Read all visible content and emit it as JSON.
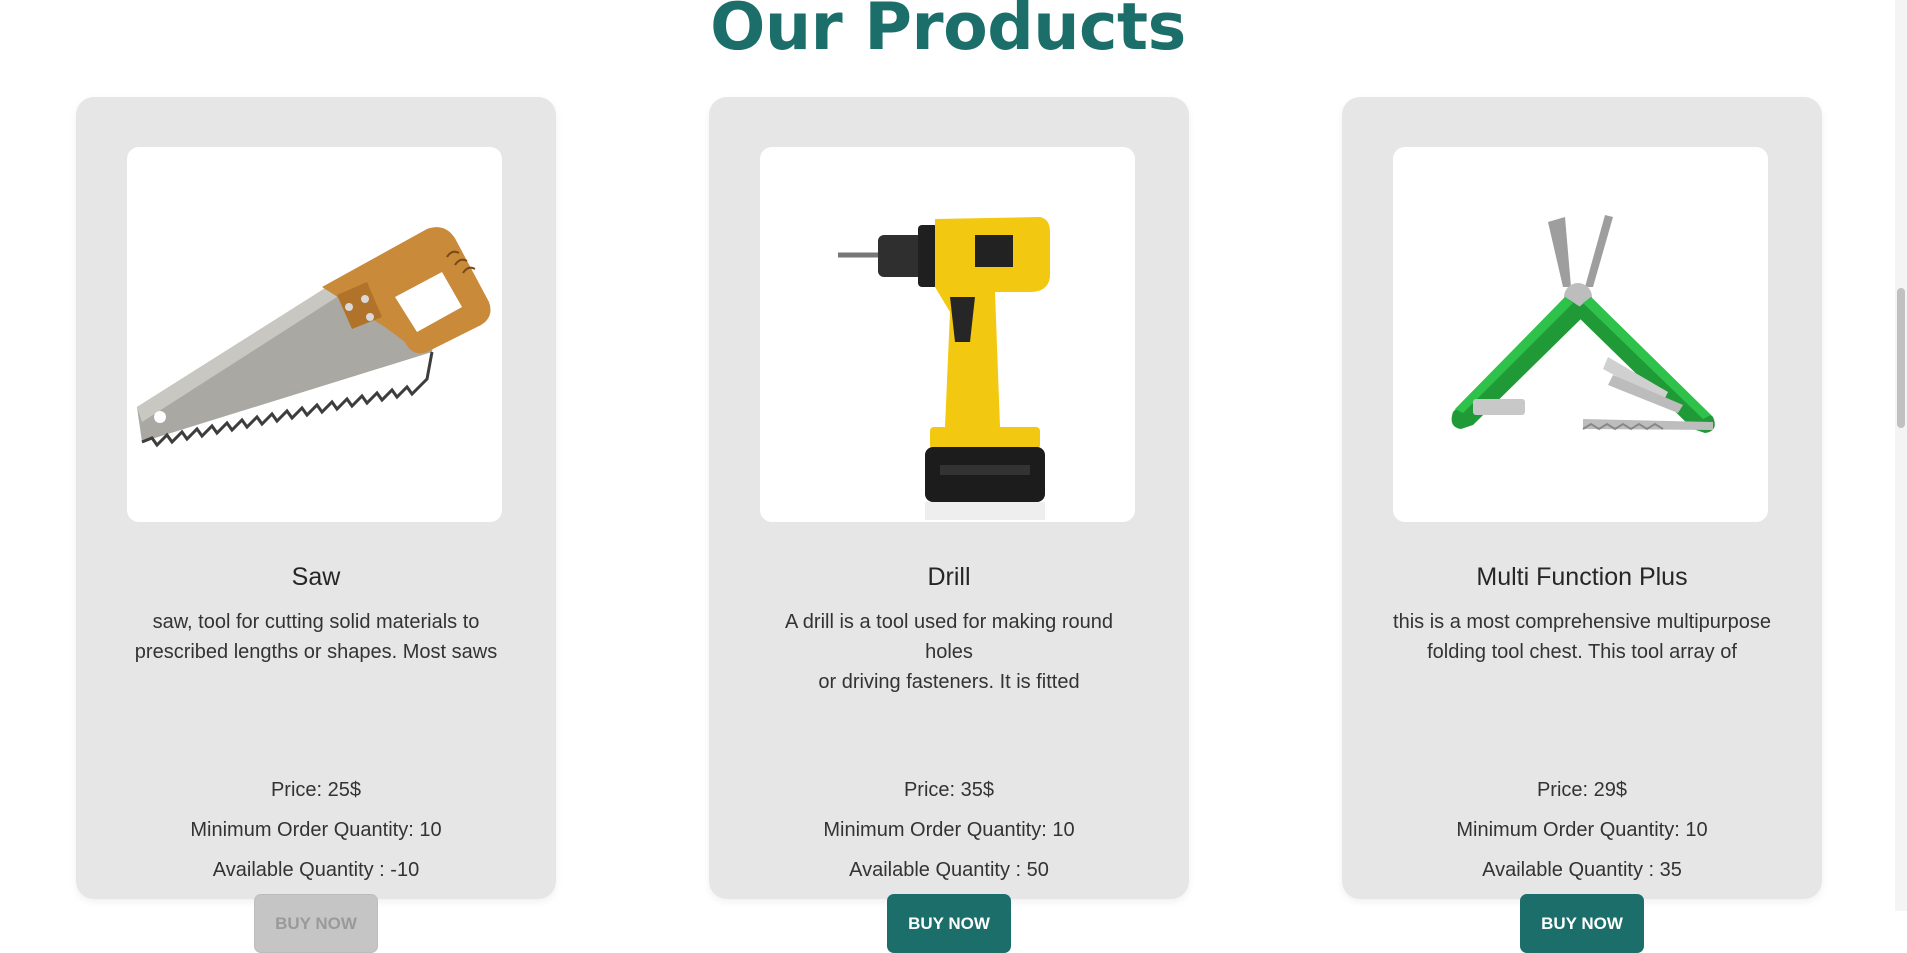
{
  "section": {
    "title": "Our Products"
  },
  "products": [
    {
      "name": "Saw",
      "image_icon": "saw-icon",
      "description_line1": "saw, tool for cutting solid materials to",
      "description_line2": "prescribed lengths or shapes. Most saws",
      "price": "Price: 25$",
      "min_order": "Minimum Order Quantity: 10",
      "available": "Available Quantity : -10",
      "button_label": "BUY NOW",
      "button_disabled": true
    },
    {
      "name": "Drill",
      "image_icon": "drill-icon",
      "description_line1": "A drill is a tool used for making round holes",
      "description_line2": "or driving fasteners. It is fitted",
      "price": "Price: 35$",
      "min_order": "Minimum Order Quantity: 10",
      "available": "Available Quantity : 50",
      "button_label": "BUY NOW",
      "button_disabled": false
    },
    {
      "name": "Multi Function Plus",
      "image_icon": "multitool-icon",
      "description_line1": "this is a most comprehensive multipurpose",
      "description_line2": "folding tool chest. This tool array of",
      "price": "Price: 29$",
      "min_order": "Minimum Order Quantity: 10",
      "available": "Available Quantity : 35",
      "button_label": "BUY NOW",
      "button_disabled": false
    }
  ],
  "colors": {
    "accent": "#1b6e6a",
    "card_bg": "#e6e6e6",
    "disabled_button": "#c5c5c5"
  }
}
